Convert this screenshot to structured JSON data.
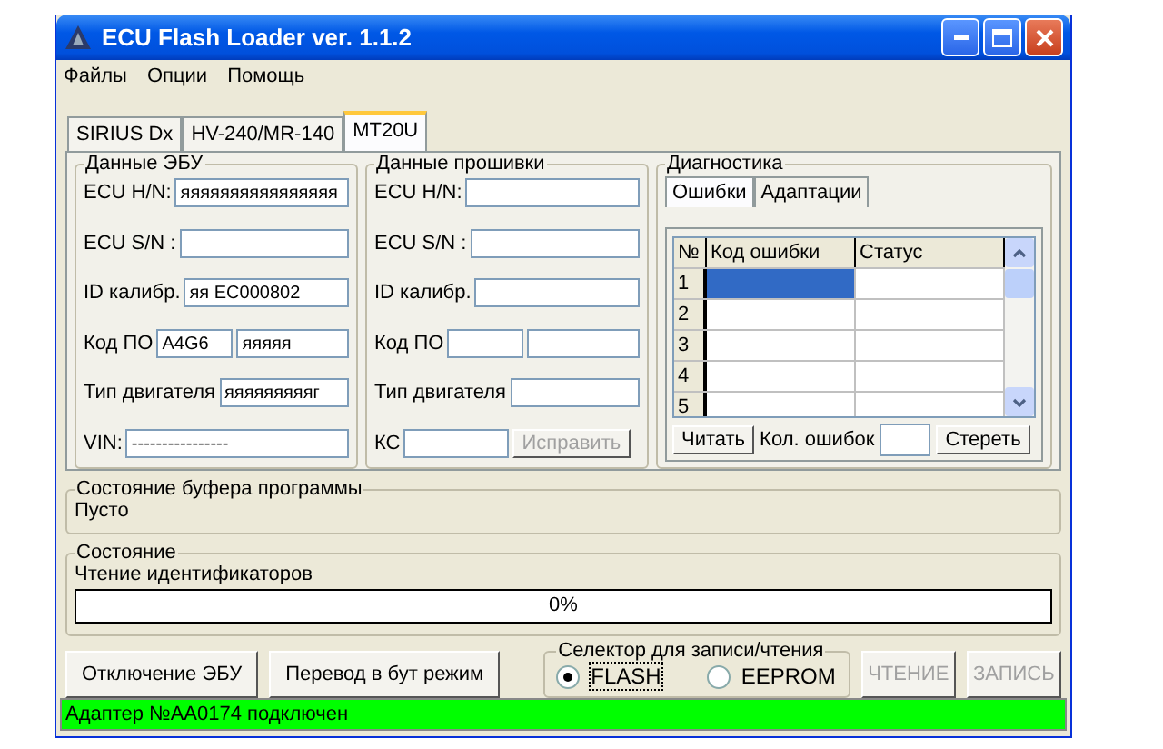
{
  "window": {
    "title": "ECU Flash Loader ver. 1.1.2"
  },
  "menu": [
    "Файлы",
    "Опции",
    "Помощь"
  ],
  "tabs": [
    {
      "label": "SIRIUS Dx",
      "selected": false
    },
    {
      "label": "HV-240/MR-140",
      "selected": false
    },
    {
      "label": "MT20U",
      "selected": true
    }
  ],
  "ecu_data": {
    "title": "Данные ЭБУ",
    "fields": [
      {
        "label": "ECU H/N:",
        "kind": "single",
        "values": [
          "яяяяяяяяяяяяяяяя"
        ]
      },
      {
        "label": "ECU S/N :",
        "kind": "single"
      },
      {
        "label": "ID калибр.",
        "kind": "single",
        "values": [
          "яя EC000802"
        ]
      },
      {
        "label": "Код ПО",
        "kind": "double",
        "values": [
          "A4G6",
          "яяяяя"
        ]
      },
      {
        "label": "Тип двигателя",
        "kind": "single",
        "values": [
          "яяяяяяяяяг"
        ]
      },
      {
        "label": "VIN:",
        "kind": "single",
        "values": [
          "----------------"
        ]
      }
    ]
  },
  "firmware_data": {
    "title": "Данные прошивки",
    "fields": [
      {
        "label": "ECU H/N:",
        "kind": "single"
      },
      {
        "label": "ECU S/N :",
        "kind": "single"
      },
      {
        "label": "ID калибр.",
        "kind": "single"
      },
      {
        "label": "Код ПО",
        "kind": "double"
      },
      {
        "label": "Тип двигателя",
        "kind": "single"
      },
      {
        "label": "КС",
        "kind": "button",
        "button": {
          "label": "Исправить",
          "disabled": true
        }
      }
    ]
  },
  "diagnostics": {
    "title": "Диагностика",
    "tabs": [
      {
        "label": "Ошибки",
        "selected": true
      },
      {
        "label": "Адаптации",
        "selected": false
      }
    ],
    "columns": [
      "№",
      "Код ошибки",
      "Статус"
    ],
    "rows": [
      {
        "num": "1",
        "selected": true
      },
      {
        "num": "2",
        "selected": false
      },
      {
        "num": "3",
        "selected": false
      },
      {
        "num": "4",
        "selected": false
      },
      {
        "num": "5",
        "selected": false
      }
    ],
    "read_button": "Читать",
    "count_label": "Кол. ошибок",
    "erase_button": "Стереть"
  },
  "buffer": {
    "title": "Состояние буфера программы",
    "text": "Пусто"
  },
  "state": {
    "title": "Состояние",
    "text": "Чтение идентификаторов",
    "progress": {
      "level": 0,
      "label": "0%"
    }
  },
  "buttons": [
    {
      "label": "Отключение ЭБУ",
      "disabled": false
    },
    {
      "label": "Перевод в бут режим",
      "disabled": false
    }
  ],
  "selector": {
    "title": "Селектор для записи/чтения",
    "options": [
      {
        "label": "FLASH",
        "selected": true
      },
      {
        "label": "EEPROM",
        "selected": false
      }
    ]
  },
  "action_buttons": [
    {
      "label": "ЧТЕНИЕ",
      "disabled": true
    },
    {
      "label": "ЗАПИСЬ",
      "disabled": true
    }
  ],
  "status_bar": {
    "text": "Адаптер №AA0174 подключен"
  }
}
